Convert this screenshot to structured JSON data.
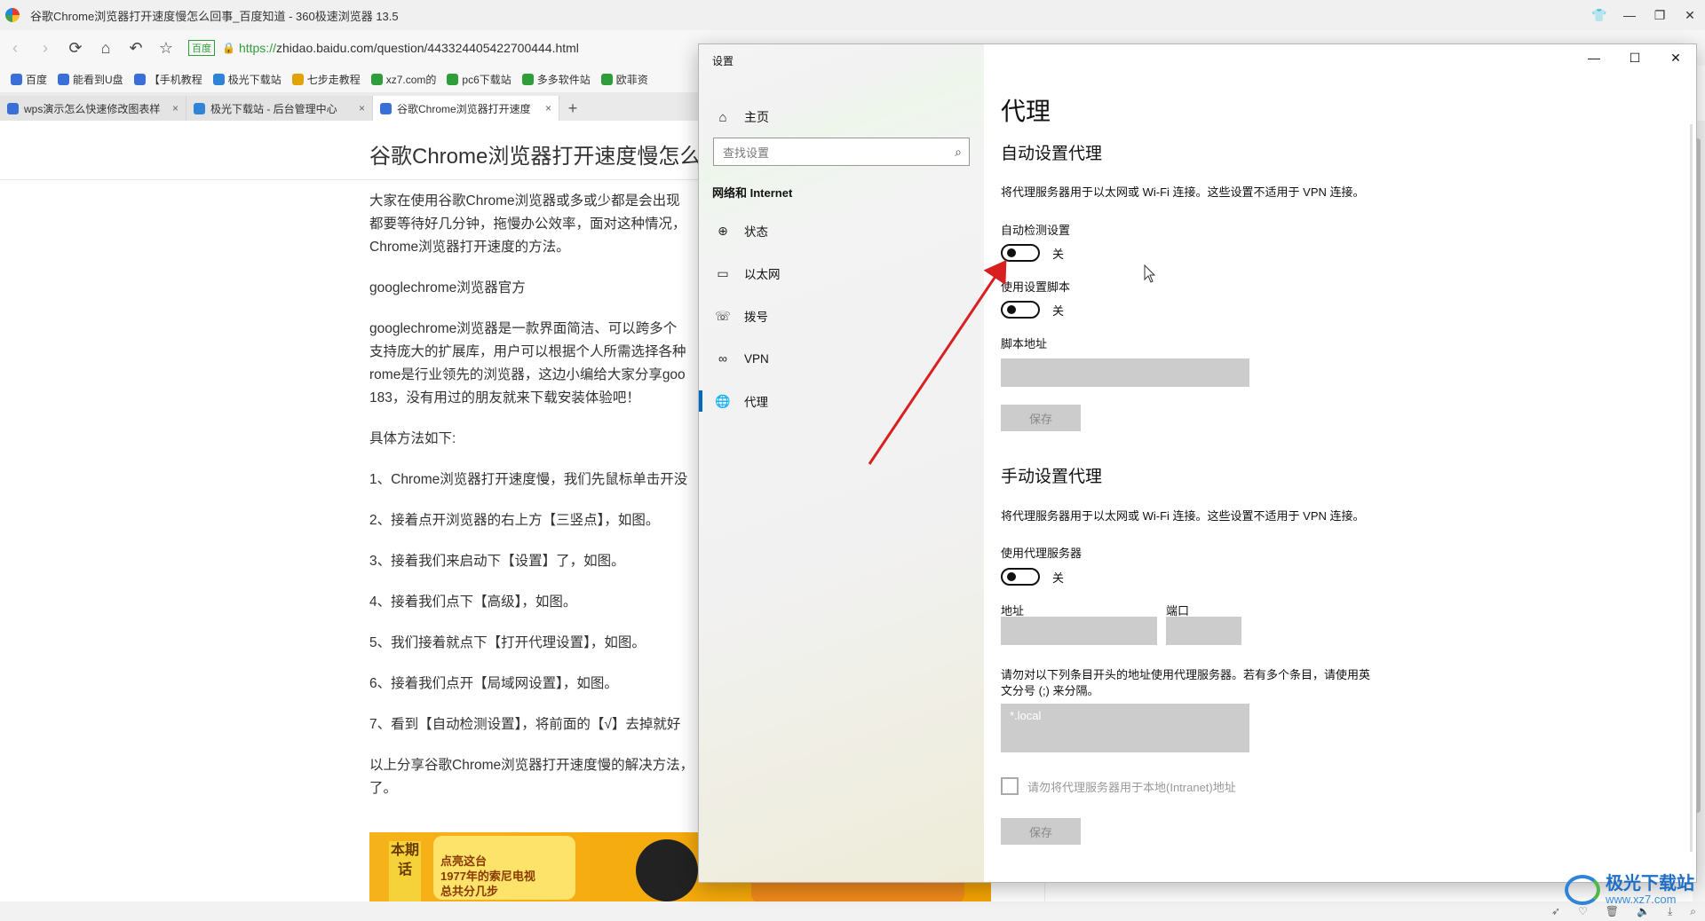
{
  "browser": {
    "window_title": "谷歌Chrome浏览器打开速度慢怎么回事_百度知道 - 360极速浏览器 13.5",
    "address_badge": "百度",
    "url_scheme": "https://",
    "url_rest": "zhidao.baidu.com/question/443324405422700444.html",
    "bookmarks": [
      {
        "label": "百度",
        "color": "#3a6fd8"
      },
      {
        "label": "能看到U盘",
        "color": "#3a6fd8"
      },
      {
        "label": "【手机教程",
        "color": "#3a6fd8"
      },
      {
        "label": "极光下载站",
        "color": "#2f84d8"
      },
      {
        "label": "七步走教程",
        "color": "#e2a200"
      },
      {
        "label": "xz7.com的",
        "color": "#2e9d3a"
      },
      {
        "label": "pc6下载站",
        "color": "#2e9d3a"
      },
      {
        "label": "多多软件站",
        "color": "#2e9d3a"
      },
      {
        "label": "欧菲资",
        "color": "#2e9d3a"
      }
    ],
    "tabs": [
      {
        "label": "wps演示怎么快速修改图表样"
      },
      {
        "label": "极光下载站 - 后台管理中心"
      },
      {
        "label": "谷歌Chrome浏览器打开速度"
      }
    ],
    "tab_close": "×",
    "tab_new": "+"
  },
  "article": {
    "title": "谷歌Chrome浏览器打开速度慢怎么回事",
    "intro_lines": [
      "大家在使用谷歌Chrome浏览器或多或少都是会出现",
      "都要等待好几分钟，拖慢办公效率，面对这种情况，",
      "Chrome浏览器打开速度的方法。"
    ],
    "subheading": "googlechrome浏览器官方",
    "desc_lines": [
      "googlechrome浏览器是一款界面简洁、可以跨多个",
      "支持庞大的扩展库，用户可以根据个人所需选择各种",
      "rome是行业领先的浏览器，这边小编给大家分享goo",
      "183，没有用过的朋友就来下载安装体验吧！"
    ],
    "method_heading": "具体方法如下:",
    "steps": [
      "1、Chrome浏览器打开速度慢，我们先鼠标单击开没",
      "2、接着点开浏览器的右上方【三竖点】，如图。",
      "3、接着我们来启动下【设置】了，如图。",
      "4、接着我们点下【高级】，如图。",
      "5、我们接着就点下【打开代理设置】，如图。",
      "6、接着我们点开【局域网设置】，如图。",
      "7、看到【自动检测设置】，将前面的【√】去掉就好"
    ],
    "summary_lines": [
      "以上分享谷歌Chrome浏览器打开速度慢的解决方法，",
      "了。"
    ],
    "banner": {
      "tag": "本期话",
      "bubble": "点亮这台\n1977年的索尼电视\n总共分几步"
    }
  },
  "settings": {
    "app_title": "设置",
    "home_label": "主页",
    "search_placeholder": "查找设置",
    "category": "网络和 Internet",
    "nav": [
      {
        "label": "状态",
        "icon": "globe-status-icon"
      },
      {
        "label": "以太网",
        "icon": "ethernet-icon"
      },
      {
        "label": "拨号",
        "icon": "dialup-icon"
      },
      {
        "label": "VPN",
        "icon": "vpn-icon"
      },
      {
        "label": "代理",
        "icon": "globe-icon",
        "active": true
      }
    ],
    "page_title": "代理",
    "auto": {
      "heading": "自动设置代理",
      "description": "将代理服务器用于以太网或 Wi-Fi 连接。这些设置不适用于 VPN 连接。",
      "detect_label": "自动检测设置",
      "detect_state": "关",
      "script_label": "使用设置脚本",
      "script_state": "关",
      "script_address_label": "脚本地址",
      "script_address_value": "",
      "save_label": "保存"
    },
    "manual": {
      "heading": "手动设置代理",
      "description": "将代理服务器用于以太网或 Wi-Fi 连接。这些设置不适用于 VPN 连接。",
      "proxy_label": "使用代理服务器",
      "proxy_state": "关",
      "address_label": "地址",
      "port_label": "端口",
      "address_value": "",
      "port_value": "",
      "exceptions_line1": "请勿对以下列条目开头的地址使用代理服务器。若有多个条目，请使用英",
      "exceptions_line2": "文分号 (;) 来分隔。",
      "exceptions_value": "*.local",
      "local_checkbox_label": "请勿将代理服务器用于本地(Intranet)地址",
      "save_label": "保存"
    }
  },
  "watermark": {
    "name": "极光下载站",
    "url": "www.xz7.com"
  },
  "colors": {
    "accent": "#0067c0",
    "arrow": "#d92020",
    "url_green": "#2e9d3a"
  }
}
